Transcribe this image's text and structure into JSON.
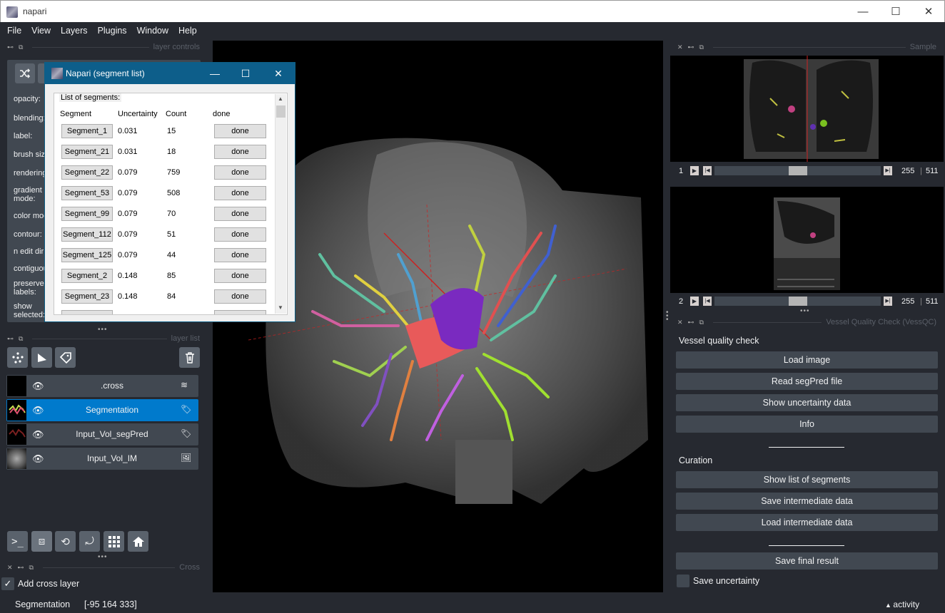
{
  "window": {
    "title": "napari",
    "minimize": "—",
    "maximize": "☐",
    "close": "✕"
  },
  "menu": [
    "File",
    "View",
    "Layers",
    "Plugins",
    "Window",
    "Help"
  ],
  "layer_controls": {
    "header": "layer controls",
    "labels": [
      "opacity:",
      "blending:",
      "label:",
      "brush siz",
      "rendering",
      "gradient\nmode:",
      "color moc",
      "contour:",
      "n edit dir",
      "contiguou",
      "preserve\nlabels:",
      "show\nselected:"
    ]
  },
  "layer_list": {
    "header": "layer list",
    "layers": [
      {
        "name": ".cross",
        "type_icon": "vectors-icon",
        "selected": false
      },
      {
        "name": "Segmentation",
        "type_icon": "labels-icon",
        "selected": true
      },
      {
        "name": "Input_Vol_segPred",
        "type_icon": "labels-icon",
        "selected": false
      },
      {
        "name": "Input_Vol_IM",
        "type_icon": "image-icon",
        "selected": false
      }
    ]
  },
  "cross_dock": {
    "header": "Cross",
    "checkbox_label": "Add cross layer",
    "checked": true
  },
  "dialog": {
    "title": "Napari (segment list)",
    "group_label": "List of segments:",
    "columns": [
      "Segment",
      "Uncertainty",
      "Count",
      "done"
    ],
    "rows": [
      {
        "segment": "Segment_1",
        "uncertainty": "0.031",
        "count": "15",
        "done": "done"
      },
      {
        "segment": "Segment_21",
        "uncertainty": "0.031",
        "count": "18",
        "done": "done"
      },
      {
        "segment": "Segment_22",
        "uncertainty": "0.079",
        "count": "759",
        "done": "done"
      },
      {
        "segment": "Segment_53",
        "uncertainty": "0.079",
        "count": "508",
        "done": "done"
      },
      {
        "segment": "Segment_99",
        "uncertainty": "0.079",
        "count": "70",
        "done": "done"
      },
      {
        "segment": "Segment_112",
        "uncertainty": "0.079",
        "count": "51",
        "done": "done"
      },
      {
        "segment": "Segment_125",
        "uncertainty": "0.079",
        "count": "44",
        "done": "done"
      },
      {
        "segment": "Segment_2",
        "uncertainty": "0.148",
        "count": "85",
        "done": "done"
      },
      {
        "segment": "Segment_23",
        "uncertainty": "0.148",
        "count": "84",
        "done": "done"
      }
    ]
  },
  "sample": {
    "header": "Sample",
    "sliders": [
      {
        "axis": "1",
        "value": "255",
        "max": "511",
        "position": 0.5
      },
      {
        "axis": "2",
        "value": "255",
        "max": "511",
        "position": 0.5
      }
    ]
  },
  "vessqc": {
    "header": "Vessel Quality Check (VessQC)",
    "title": "Vessel quality check",
    "buttons1": [
      "Load image",
      "Read segPred file",
      "Show uncertainty data",
      "Info"
    ],
    "curation_label": "Curation",
    "buttons2": [
      "Show list of segments",
      "Save intermediate data",
      "Load intermediate data"
    ],
    "final_button": "Save final result",
    "checkbox_label": "Save uncertainty",
    "checked": false
  },
  "status": {
    "layer": "Segmentation",
    "coords": "[-95 164 333]",
    "activity": "activity"
  }
}
